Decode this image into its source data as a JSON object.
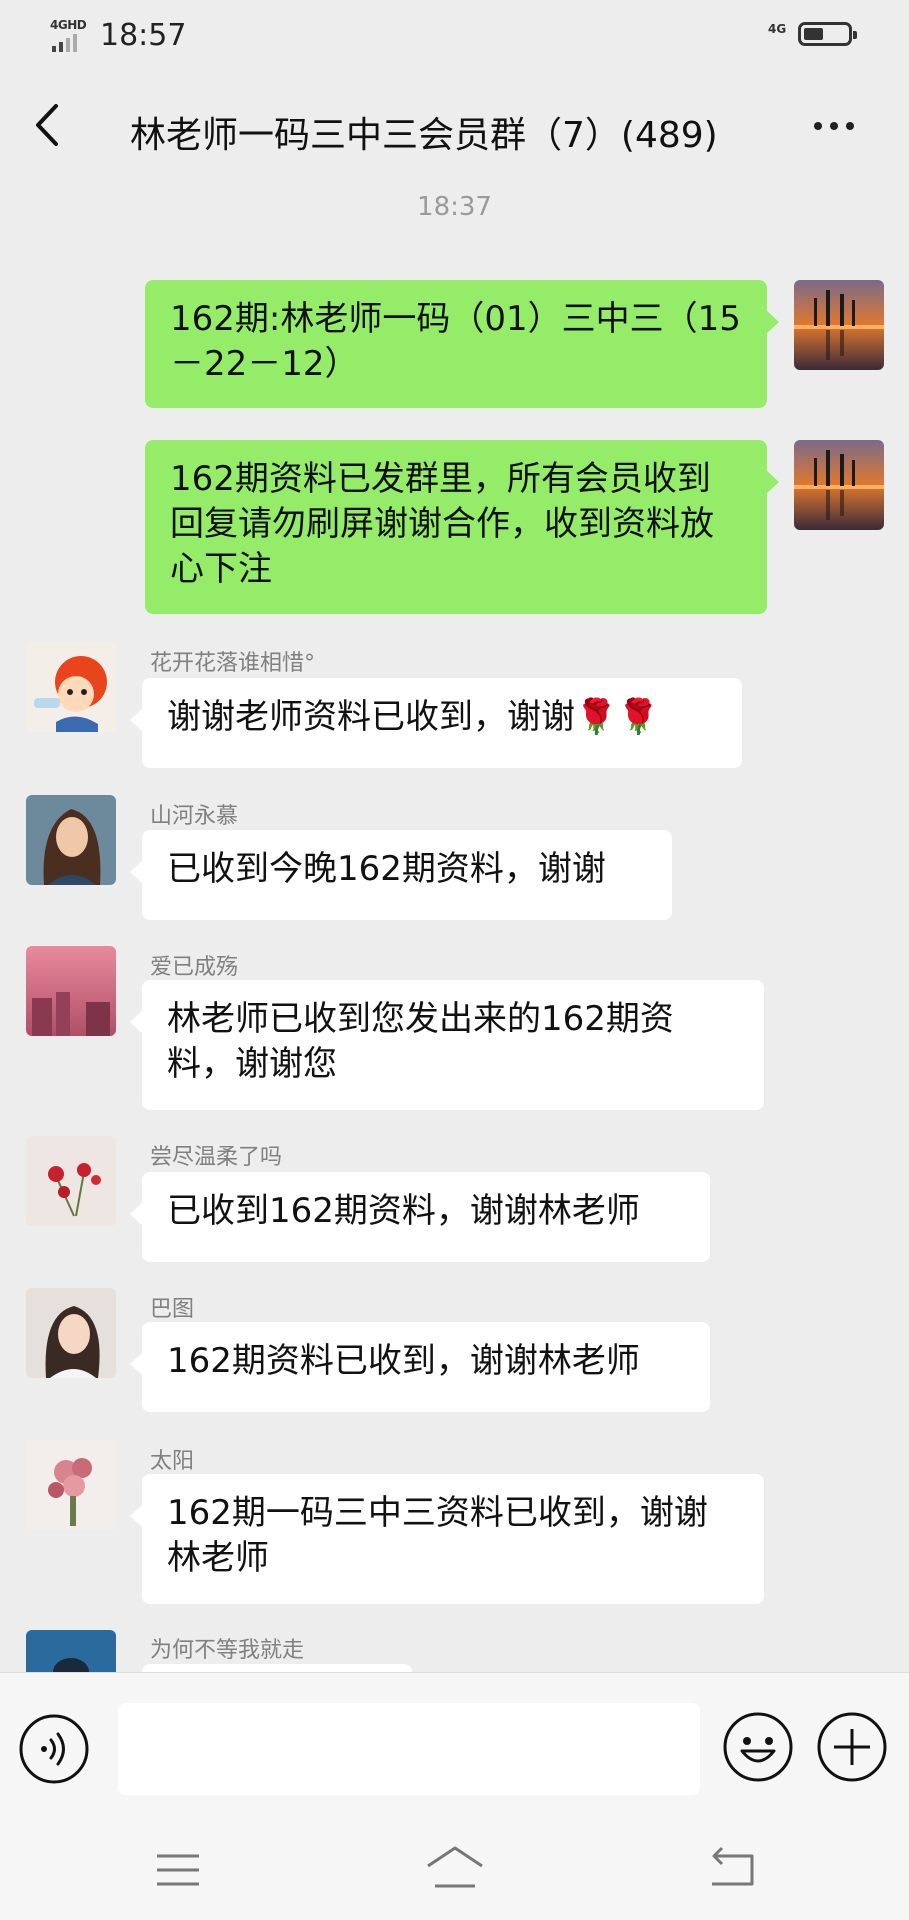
{
  "status_bar": {
    "network_left": "4GHD",
    "time": "18:57",
    "network_right": "4G",
    "battery_level": 0.45
  },
  "header": {
    "title": "林老师一码三中三会员群（7）(489)"
  },
  "chat": {
    "timestamp": "18:37",
    "messages": [
      {
        "sender": "",
        "text": "162期:林老师一码（01）三中三（15－22－12）",
        "mine": true
      },
      {
        "sender": "",
        "text": "162期资料已发群里，所有会员收到回复请勿刷屏谢谢合作，收到资料放心下注",
        "mine": true
      },
      {
        "sender": "花开花落谁相惜°",
        "text": "谢谢老师资料已收到，谢谢🌹🌹",
        "mine": false
      },
      {
        "sender": "山河永慕",
        "text": "已收到今晚162期资料，谢谢",
        "mine": false
      },
      {
        "sender": "爱已成殇",
        "text": "林老师已收到您发出来的162期资料，谢谢您",
        "mine": false
      },
      {
        "sender": "尝尽温柔了吗",
        "text": "已收到162期资料，谢谢林老师",
        "mine": false
      },
      {
        "sender": "巴图",
        "text": "162期资料已收到，谢谢林老师",
        "mine": false
      },
      {
        "sender": "太阳",
        "text": "162期一码三中三资料已收到，谢谢林老师",
        "mine": false
      },
      {
        "sender": "为何不等我就走",
        "text": "",
        "mine": false
      }
    ]
  },
  "input_bar": {
    "placeholder": ""
  },
  "icons": {
    "back": "chevron-left-icon",
    "more": "more-dots-icon",
    "voice": "voice-icon",
    "emoji": "emoji-icon",
    "plus": "plus-icon",
    "nav_menu": "menu-icon",
    "nav_home": "home-icon",
    "nav_back": "back-icon"
  },
  "colors": {
    "background": "#ededed",
    "my_bubble": "#95ec69",
    "other_bubble": "#ffffff"
  }
}
